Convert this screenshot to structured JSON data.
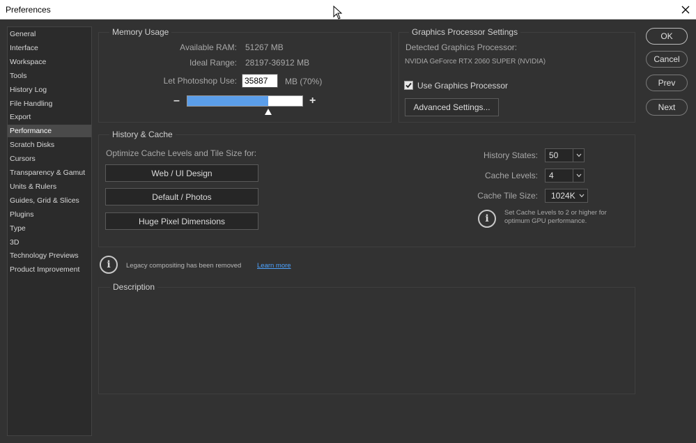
{
  "window": {
    "title": "Preferences"
  },
  "nav": {
    "items": [
      {
        "label": "General"
      },
      {
        "label": "Interface"
      },
      {
        "label": "Workspace"
      },
      {
        "label": "Tools"
      },
      {
        "label": "History Log"
      },
      {
        "label": "File Handling"
      },
      {
        "label": "Export"
      },
      {
        "label": "Performance",
        "active": true
      },
      {
        "label": "Scratch Disks"
      },
      {
        "label": "Cursors"
      },
      {
        "label": "Transparency & Gamut"
      },
      {
        "label": "Units & Rulers"
      },
      {
        "label": "Guides, Grid & Slices"
      },
      {
        "label": "Plugins"
      },
      {
        "label": "Type"
      },
      {
        "label": "3D"
      },
      {
        "label": "Technology Previews"
      },
      {
        "label": "Product Improvement"
      }
    ]
  },
  "memory": {
    "title": "Memory Usage",
    "available_label": "Available RAM:",
    "available_value": "51267 MB",
    "ideal_label": "Ideal Range:",
    "ideal_value": "28197-36912 MB",
    "let_label": "Let Photoshop Use:",
    "let_value": "35887",
    "let_suffix": "MB (70%)",
    "slider_fraction": 0.7,
    "minus": "–",
    "plus": "+"
  },
  "gpu": {
    "title": "Graphics Processor Settings",
    "detected_label": "Detected Graphics Processor:",
    "detected_value": "NVIDIA GeForce RTX 2060 SUPER (NVIDIA)",
    "use_label": "Use Graphics Processor",
    "use_checked": true,
    "advanced_button": "Advanced Settings..."
  },
  "history_cache": {
    "title": "History & Cache",
    "optimize_label": "Optimize Cache Levels and Tile Size for:",
    "presets": [
      "Web / UI Design",
      "Default / Photos",
      "Huge Pixel Dimensions"
    ],
    "history_states_label": "History States:",
    "history_states_value": "50",
    "cache_levels_label": "Cache Levels:",
    "cache_levels_value": "4",
    "cache_tile_label": "Cache Tile Size:",
    "cache_tile_value": "1024K",
    "note_line1": "Set Cache Levels to 2 or higher for",
    "note_line2": "optimum GPU performance."
  },
  "legacy": {
    "message": "Legacy compositing has been removed",
    "link": "Learn more"
  },
  "description": {
    "title": "Description"
  },
  "buttons": {
    "ok": "OK",
    "cancel": "Cancel",
    "prev": "Prev",
    "next": "Next"
  },
  "icons": {
    "close": "close-icon",
    "info": "info-icon",
    "check": "checkmark-icon",
    "chevron": "chevron-down-icon",
    "cursor": "mouse-pointer-icon"
  },
  "colors": {
    "background": "#323232",
    "slider_fill": "#5b9ee9",
    "link": "#4da3ff"
  }
}
